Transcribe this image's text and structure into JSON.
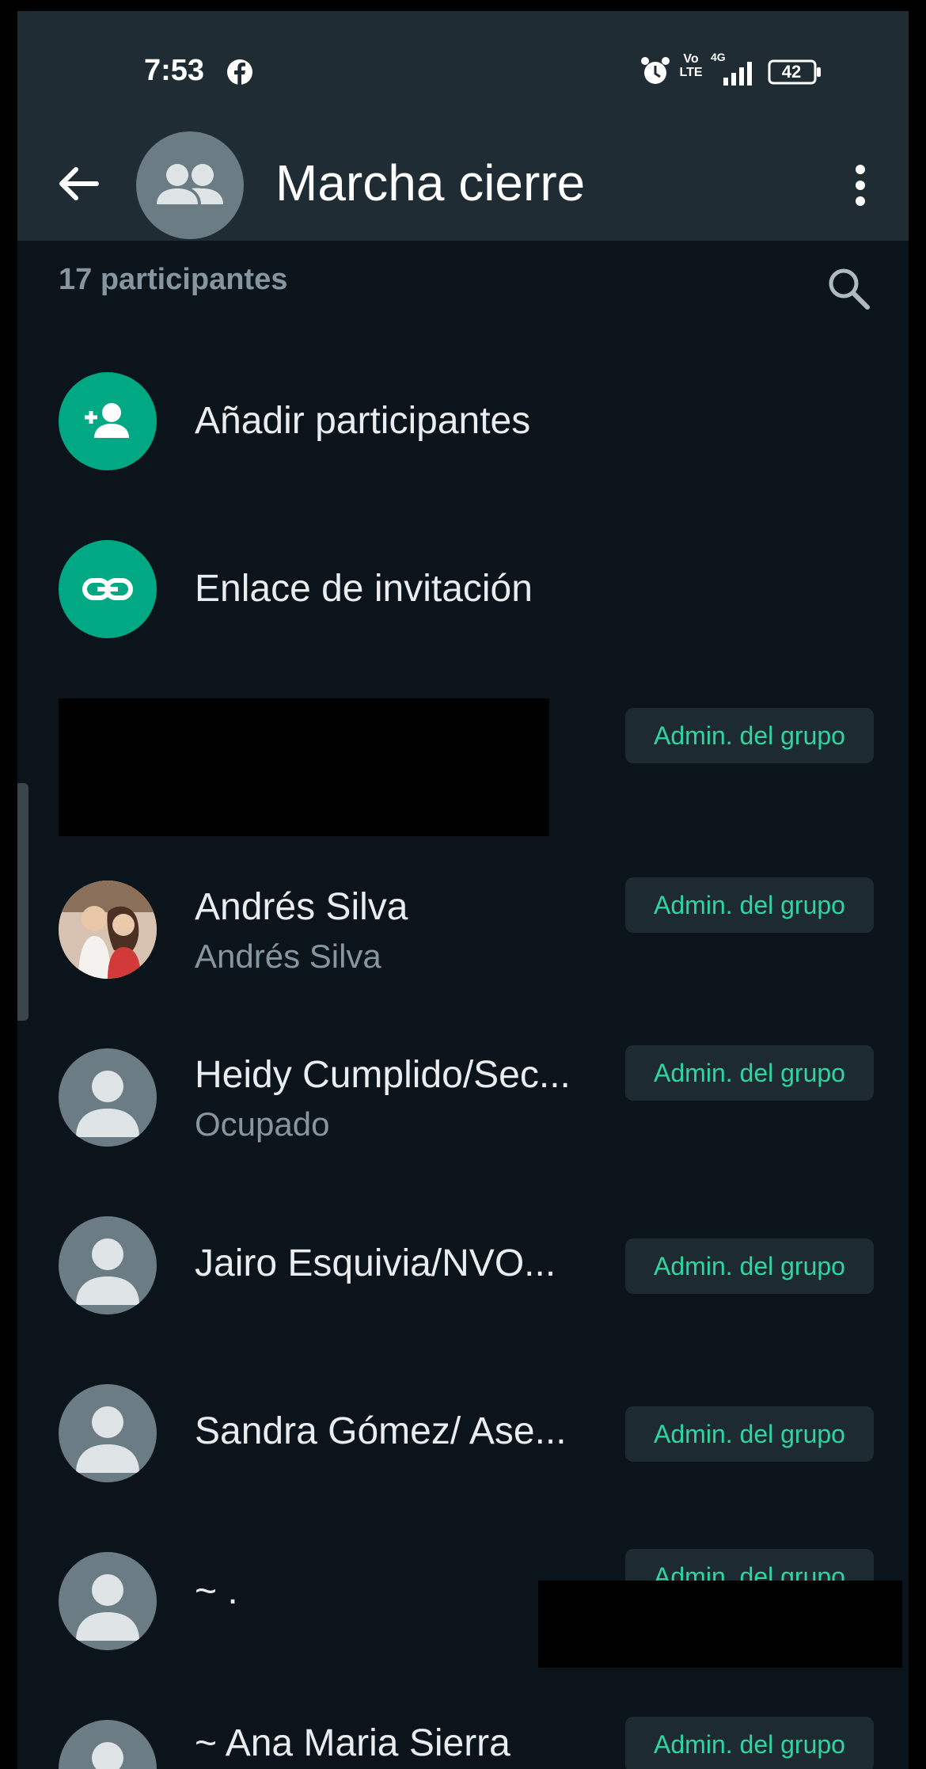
{
  "status_bar": {
    "time": "7:53",
    "volte": "Vo LTE",
    "network": "4G",
    "battery": "42",
    "icons": [
      "facebook-icon",
      "alarm-icon",
      "volte-icon",
      "signal-icon",
      "battery-icon"
    ]
  },
  "header": {
    "title": "Marcha cierre",
    "icons": [
      "back-arrow-icon",
      "group-avatar-icon",
      "more-vert-icon"
    ]
  },
  "participants": {
    "count_label": "17 participantes",
    "search_icon": "search-icon"
  },
  "actions": [
    {
      "label": "Añadir participantes",
      "icon": "add-person-icon"
    },
    {
      "label": "Enlace de invitación",
      "icon": "link-icon"
    }
  ],
  "members": [
    {
      "name": "",
      "status": "",
      "badge": "Admin. del grupo",
      "redacted": true
    },
    {
      "name": "Andrés Silva",
      "status": "Andrés Silva",
      "badge": "Admin. del grupo",
      "photo": true
    },
    {
      "name": "Heidy Cumplido/Sec...",
      "status": "Ocupado",
      "badge": "Admin. del grupo"
    },
    {
      "name": "Jairo Esquivia/NVO...",
      "status": "",
      "badge": "Admin. del grupo"
    },
    {
      "name": "Sandra Gómez/ Ase...",
      "status": "",
      "badge": "Admin. del grupo"
    },
    {
      "name": "~ .",
      "status": "",
      "badge": "Admin. del grupo",
      "redacted": true
    },
    {
      "name": "~ Ana Maria Sierra",
      "status": "",
      "badge": "Admin. del grupo"
    }
  ],
  "colors": {
    "background": "#0b141a",
    "header": "#1f2c34",
    "accent": "#00a884",
    "badge_text": "#2fd5a0",
    "secondary_text": "#8696a0"
  }
}
